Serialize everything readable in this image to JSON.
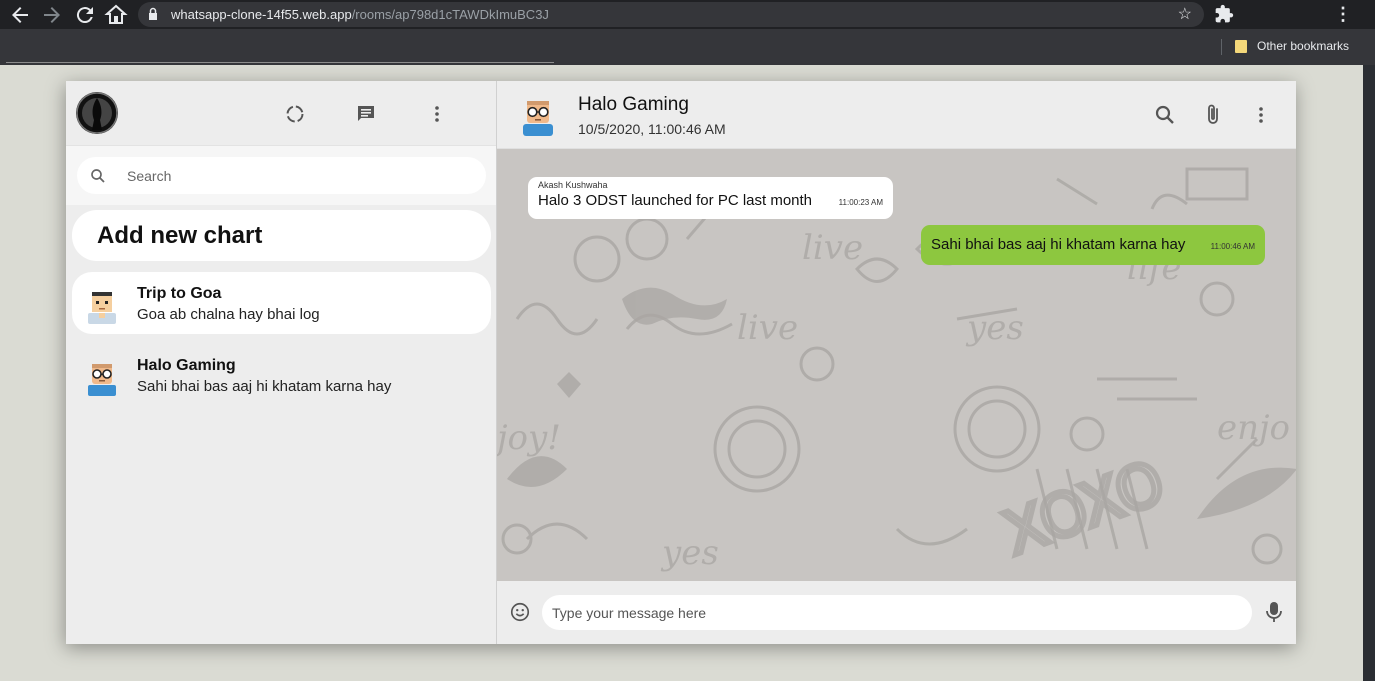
{
  "browser": {
    "url_host": "whatsapp-clone-14f55.web.app",
    "url_path": "/rooms/ap798d1cTAWDkImuBC3J",
    "bookmark_folder": "Other bookmarks"
  },
  "sidebar": {
    "search_placeholder": "Search",
    "add_chat_label": "Add new chart",
    "chats": [
      {
        "name": "Trip to Goa",
        "last_message": "Goa ab chalna hay bhai log",
        "active": true
      },
      {
        "name": "Halo Gaming",
        "last_message": "Sahi bhai bas aaj hi khatam karna hay",
        "active": false
      }
    ]
  },
  "room": {
    "name": "Halo Gaming",
    "last_seen": "10/5/2020, 11:00:46 AM"
  },
  "messages": [
    {
      "sender": "Akash Kushwaha",
      "text": "Halo 3 ODST launched for PC last month",
      "time": "11:00:23 AM",
      "outgoing": false
    },
    {
      "sender": "",
      "text": "Sahi bhai bas aaj hi khatam karna hay",
      "time": "11:00:46 AM",
      "outgoing": true
    }
  ],
  "composer": {
    "placeholder": "Type your message here"
  },
  "colors": {
    "outgoing_bubble": "#8dc73f",
    "incoming_bubble": "#ffffff",
    "chat_background": "#c8c5c2",
    "panel": "#ededed"
  },
  "icons": [
    "back-icon",
    "forward-icon",
    "reload-icon",
    "home-icon",
    "lock-icon",
    "star-icon",
    "puzzle-icon",
    "more-vert-icon",
    "status-icon",
    "chat-icon",
    "search-icon",
    "attach-icon",
    "emoji-icon",
    "mic-icon"
  ]
}
